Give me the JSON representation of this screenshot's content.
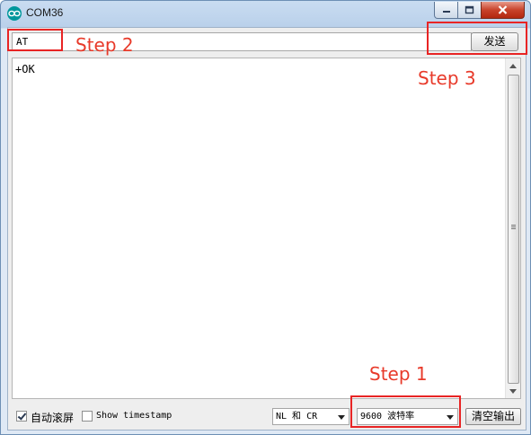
{
  "window": {
    "title": "COM36"
  },
  "send": {
    "input_value": "AT",
    "button_label": "发送"
  },
  "output": {
    "text": "+OK"
  },
  "bottom": {
    "autoscroll_label": "自动滚屏",
    "autoscroll_checked": true,
    "timestamp_label": "Show timestamp",
    "timestamp_checked": false,
    "line_ending_value": "NL 和 CR",
    "baud_value": "9600 波特率",
    "clear_label": "清空输出"
  },
  "annotations": {
    "step1": "Step 1",
    "step2": "Step 2",
    "step3": "Step 3"
  },
  "colors": {
    "annotation": "#e82424",
    "app_logo": "#00979c"
  }
}
